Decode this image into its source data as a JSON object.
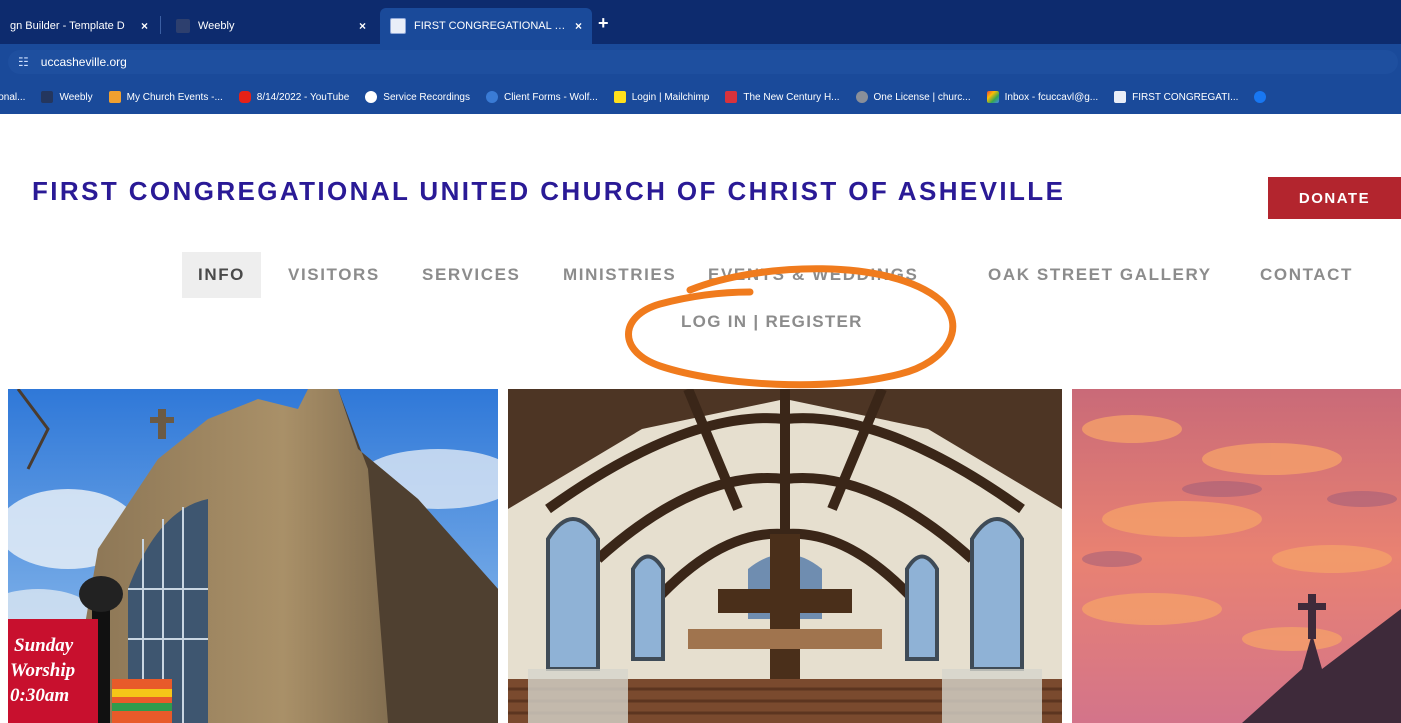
{
  "browser": {
    "tabs": [
      {
        "title": "gn Builder - Template D",
        "close": "×"
      },
      {
        "title": "Weebly",
        "close": "×"
      },
      {
        "title": "FIRST CONGREGATIONAL UNIT",
        "close": "×"
      }
    ],
    "new_tab": "+",
    "url": "uccasheville.org",
    "bookmarks": [
      "ional...",
      "Weebly",
      "My Church Events -...",
      "8/14/2022 - YouTube",
      "Service Recordings",
      "Client Forms - Wolf...",
      "Login | Mailchimp",
      "The New Century H...",
      "One License | churc...",
      "Inbox - fcuccavl@g...",
      "FIRST CONGREGATI..."
    ]
  },
  "site": {
    "title": "FIRST CONGREGATIONAL UNITED CHURCH OF CHRIST OF ASHEVILLE",
    "donate": "DONATE",
    "nav": {
      "info": "INFO",
      "visitors": "VISITORS",
      "services": "SERVICES",
      "ministries": "MINISTRIES",
      "events": "EVENTS & WEDDINGS",
      "gallery": "OAK STREET GALLERY",
      "contact": "CONTACT",
      "login": "LOG IN | REGISTER"
    }
  },
  "banner_sign": {
    "line1": "Sunday",
    "line2": "Worship",
    "line3": "0:30am"
  },
  "colors": {
    "title": "#2a1a96",
    "donate_bg": "#b3252e",
    "nav_text": "#8c8c8c",
    "annotation": "#f07b1d",
    "tabbar": "#0d2b6e",
    "toolbar": "#1a4a9a"
  },
  "icons": {
    "site_info": "tune-icon",
    "new_tab": "plus-icon",
    "tab_close": "close-icon"
  }
}
